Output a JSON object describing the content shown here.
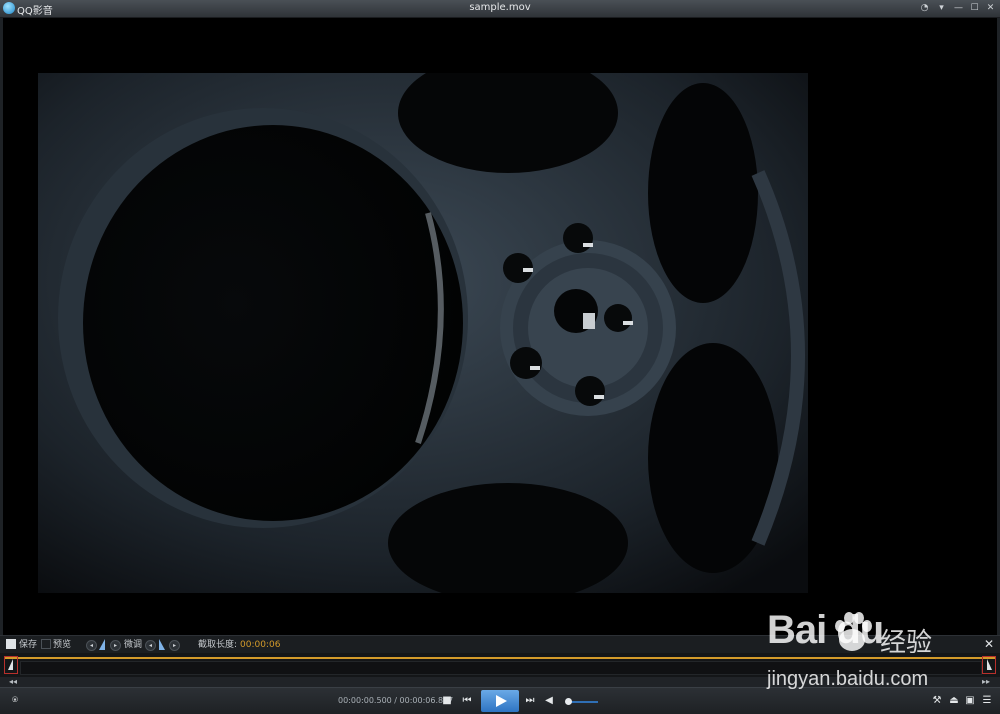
{
  "window": {
    "app_name": "QQ影音",
    "title": "sample.mov",
    "buttons": [
      "skin-icon",
      "menu-icon",
      "minimize-icon",
      "maximize-icon",
      "close-icon"
    ]
  },
  "clip_toolbar": {
    "save_label": "保存",
    "preview_label": "预览",
    "finetune_label": "微调",
    "length_label": "截取长度:",
    "length_value": "00:00:06",
    "close_symbol": "✕"
  },
  "timeline": {
    "accent_color": "#d49b2a",
    "marker_color": "#b8302c"
  },
  "controls": {
    "time_display": "00:00:00.500 / 00:00:06.837",
    "accent_color": "#3b82d0"
  },
  "watermark": {
    "logo": "Bai du",
    "chinese": "经验",
    "url": "jingyan.baidu.com"
  }
}
